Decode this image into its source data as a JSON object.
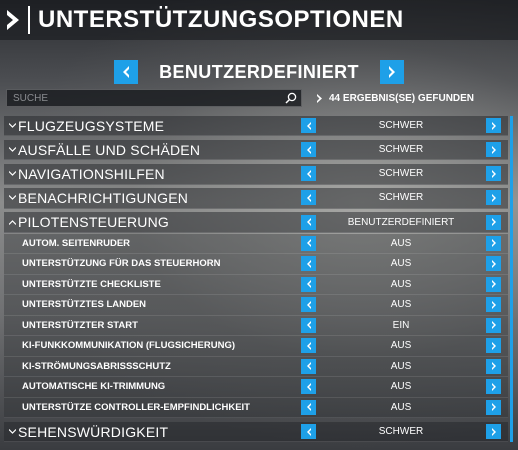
{
  "header": {
    "title": "UNTERSTÜTZUNGSOPTIONEN"
  },
  "preset": {
    "label": "BENUTZERDEFINIERT"
  },
  "search": {
    "placeholder": "SUCHE",
    "value": ""
  },
  "results": {
    "text": "44 ERGEBNIS(SE) GEFUNDEN"
  },
  "colors": {
    "accent": "#1ea0e8"
  },
  "categories_top": [
    {
      "label": "FLUGZEUGSYSTEME",
      "value": "SCHWER"
    },
    {
      "label": "AUSFÄLLE UND SCHÄDEN",
      "value": "SCHWER"
    },
    {
      "label": "NAVIGATIONSHILFEN",
      "value": "SCHWER"
    },
    {
      "label": "BENACHRICHTIGUNGEN",
      "value": "SCHWER"
    }
  ],
  "open_category": {
    "label": "PILOTENSTEUERUNG",
    "value": "BENUTZERDEFINIERT",
    "items": [
      {
        "label": "AUTOM. SEITENRUDER",
        "value": "AUS"
      },
      {
        "label": "UNTERSTÜTZUNG FÜR DAS STEUERHORN",
        "value": "AUS"
      },
      {
        "label": "UNTERSTÜTZTE CHECKLISTE",
        "value": "AUS"
      },
      {
        "label": "UNTERSTÜTZTES LANDEN",
        "value": "AUS"
      },
      {
        "label": "UNTERSTÜTZTER START",
        "value": "EIN"
      },
      {
        "label": "KI-FUNKKOMMUNIKATION (FLUGSICHERUNG)",
        "value": "AUS"
      },
      {
        "label": "KI-STRÖMUNGSABRISSSCHUTZ",
        "value": "AUS"
      },
      {
        "label": "AUTOMATISCHE KI-TRIMMUNG",
        "value": "AUS"
      },
      {
        "label": "UNTERSTÜTZE CONTROLLER-EMPFINDLICHKEIT",
        "value": "AUS"
      }
    ]
  },
  "categories_bottom": [
    {
      "label": "SEHENSWÜRDIGKEIT",
      "value": "SCHWER"
    }
  ]
}
